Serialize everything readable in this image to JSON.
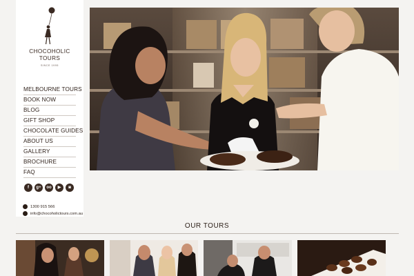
{
  "brand": {
    "name_line1": "CHOCOHOLIC",
    "name_line2": "TOURS",
    "since": "SINCE 1995"
  },
  "nav": {
    "items": [
      {
        "label": "MELBOURNE TOURS"
      },
      {
        "label": "BOOK NOW"
      },
      {
        "label": "BLOG"
      },
      {
        "label": "GIFT SHOP"
      },
      {
        "label": "CHOCOLATE GUIDES"
      },
      {
        "label": "ABOUT US"
      },
      {
        "label": "GALLERY"
      },
      {
        "label": "BROCHURE"
      },
      {
        "label": "FAQ"
      }
    ]
  },
  "social": [
    {
      "icon": "facebook-icon",
      "glyph": "f"
    },
    {
      "icon": "google-plus-icon",
      "glyph": "g+"
    },
    {
      "icon": "tripadvisor-icon",
      "glyph": "oo"
    },
    {
      "icon": "youtube-icon",
      "glyph": "▶"
    },
    {
      "icon": "instagram-icon",
      "glyph": "◙"
    }
  ],
  "contact": {
    "phone": "1300 915 566",
    "email": "info@chocoholictours.com.au"
  },
  "tours": {
    "title": "OUR TOURS"
  },
  "colors": {
    "background": "#f4f3f1",
    "text": "#2a1d16",
    "chocolate": "#4a2a18"
  }
}
